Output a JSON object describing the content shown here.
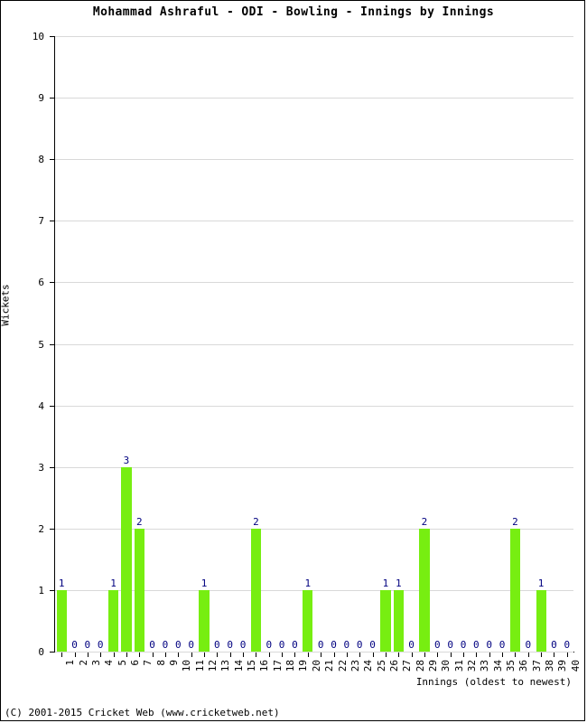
{
  "chart_data": {
    "type": "bar",
    "title": "Mohammad Ashraful - ODI - Bowling - Innings by Innings",
    "xlabel": "Innings (oldest to newest)",
    "ylabel": "Wickets",
    "ylim": [
      0,
      10
    ],
    "ytick_labels": [
      "0",
      "1",
      "2",
      "3",
      "4",
      "5",
      "6",
      "7",
      "8",
      "9",
      "10"
    ],
    "yticks": [
      0,
      1,
      2,
      3,
      4,
      5,
      6,
      7,
      8,
      9,
      10
    ],
    "grid": true,
    "legend": null,
    "bar_color": "#77ee11",
    "value_label_color": "#000080",
    "categories": [
      "1",
      "2",
      "3",
      "4",
      "5",
      "6",
      "7",
      "8",
      "9",
      "10",
      "11",
      "12",
      "13",
      "14",
      "15",
      "16",
      "17",
      "18",
      "19",
      "20",
      "21",
      "22",
      "23",
      "24",
      "25",
      "26",
      "27",
      "28",
      "29",
      "30",
      "31",
      "32",
      "33",
      "34",
      "35",
      "36",
      "37",
      "38",
      "39",
      "40"
    ],
    "values": [
      1,
      0,
      0,
      0,
      1,
      3,
      2,
      0,
      0,
      0,
      0,
      1,
      0,
      0,
      0,
      2,
      0,
      0,
      0,
      1,
      0,
      0,
      0,
      0,
      0,
      1,
      1,
      0,
      2,
      0,
      0,
      0,
      0,
      0,
      0,
      2,
      0,
      1,
      0,
      0
    ]
  },
  "footer": {
    "copyright": "(C) 2001-2015 Cricket Web (www.cricketweb.net)"
  }
}
